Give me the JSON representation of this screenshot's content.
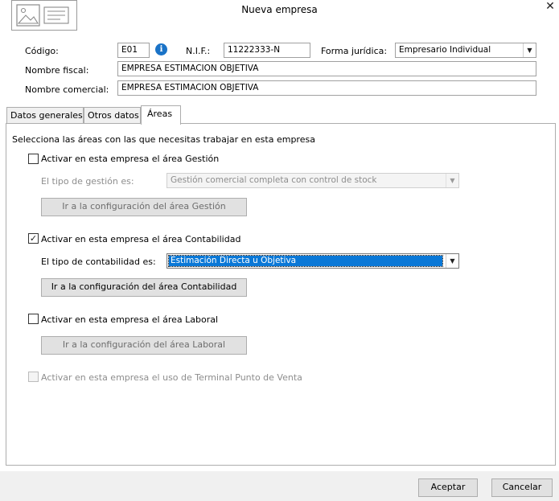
{
  "window": {
    "title": "Nueva empresa",
    "close_glyph": "✕"
  },
  "header": {
    "codigo_label": "Código:",
    "codigo_value": "E01",
    "nif_label": "N.I.F.:",
    "nif_value": "11222333-N",
    "forma_label": "Forma jurídica:",
    "forma_value": "Empresario Individual",
    "nombre_fiscal_label": "Nombre fiscal:",
    "nombre_fiscal_value": "EMPRESA ESTIMACION OBJETIVA",
    "nombre_comercial_label": "Nombre comercial:",
    "nombre_comercial_value": "EMPRESA ESTIMACION OBJETIVA"
  },
  "tabs": [
    {
      "label": "Datos generales",
      "active": false
    },
    {
      "label": "Otros datos",
      "active": false
    },
    {
      "label": "Áreas",
      "active": true
    }
  ],
  "areas": {
    "intro": "Selecciona las áreas con las que necesitas trabajar en esta empresa",
    "gestion": {
      "checkbox_label": "Activar en esta empresa el área Gestión",
      "checked": false,
      "tipo_label": "El tipo de gestión es:",
      "tipo_value": "Gestión comercial completa con control de stock",
      "config_button": "Ir a la configuración del área Gestión"
    },
    "contabilidad": {
      "checkbox_label": "Activar en esta empresa el área Contabilidad",
      "checked": true,
      "tipo_label": "El tipo de contabilidad es:",
      "tipo_value": "Estimación Directa u Objetiva",
      "config_button": "Ir a la configuración del área Contabilidad"
    },
    "laboral": {
      "checkbox_label": "Activar en esta empresa el área Laboral",
      "checked": false,
      "config_button": "Ir a la configuración del área Laboral"
    },
    "tpv": {
      "checkbox_label": "Activar en esta empresa el uso de Terminal Punto de Venta",
      "checked": false
    }
  },
  "footer": {
    "accept_label": "Aceptar",
    "cancel_label": "Cancelar"
  },
  "colors": {
    "selection": "#0a78d7",
    "info_icon": "#1a73c7",
    "footer_bg": "#f0f0f0"
  }
}
